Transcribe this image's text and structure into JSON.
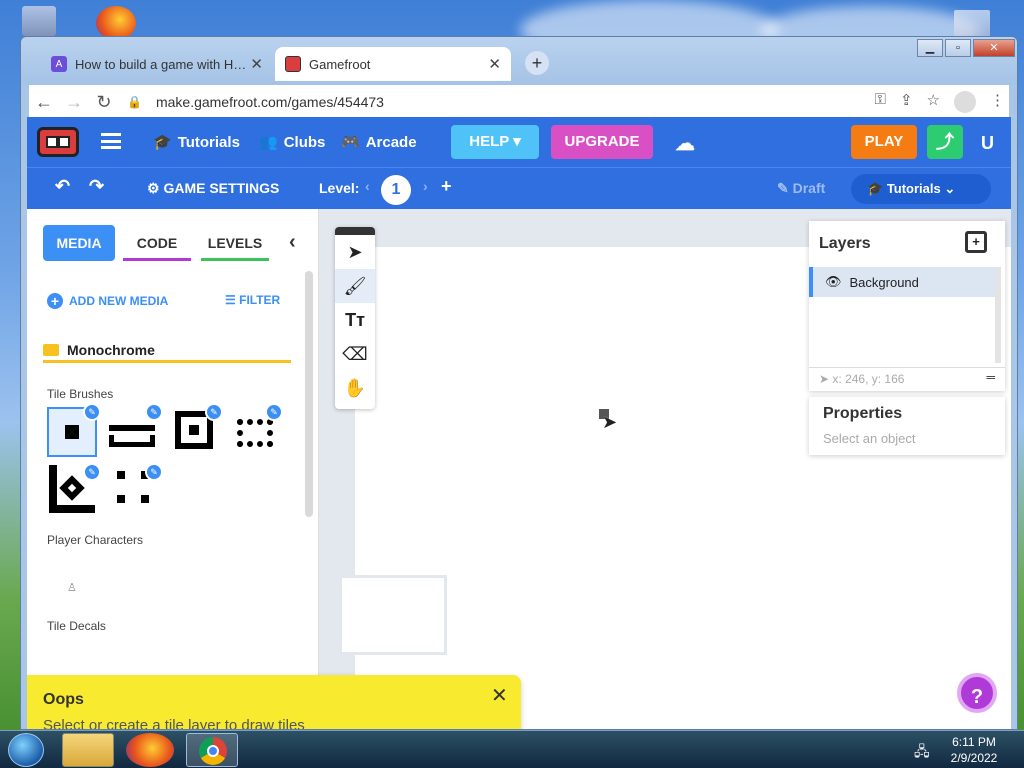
{
  "browser": {
    "tabs": [
      {
        "label": "How to build a game with HTML...",
        "favicon": "hashnode-icon"
      },
      {
        "label": "Gamefroot",
        "favicon": "gamefroot-icon"
      }
    ],
    "url": "make.gamefroot.com/games/454473"
  },
  "topnav": {
    "tutorials": "Tutorials",
    "clubs": "Clubs",
    "arcade": "Arcade",
    "help": "HELP",
    "upgrade": "UPGRADE",
    "play": "PLAY",
    "user_initial": "U"
  },
  "subnav": {
    "game_settings": "GAME SETTINGS",
    "level_label": "Level:",
    "level_number": "1",
    "draft": "Draft",
    "tutorials": "Tutorials"
  },
  "left_panel": {
    "tabs": [
      "MEDIA",
      "CODE",
      "LEVELS"
    ],
    "add_new_media": "ADD NEW MEDIA",
    "filter": "FILTER",
    "folder": "Monochrome",
    "sections": [
      "Tile Brushes",
      "Player Characters",
      "Tile Decals"
    ]
  },
  "layers": {
    "title": "Layers",
    "items": [
      "Background"
    ],
    "coords": "x: 246, y: 166"
  },
  "properties": {
    "title": "Properties",
    "hint": "Select an object"
  },
  "toast": {
    "title": "Oops",
    "message": "Select or create a tile layer to draw tiles"
  },
  "help_fab": "?",
  "taskbar": {
    "time": "6:11 PM",
    "date": "2/9/2022"
  },
  "colors": {
    "brand_blue": "#2f6fe0",
    "help": "#4fc3f7",
    "upgrade": "#d94fc4",
    "play": "#f57c12",
    "share": "#2ecc71",
    "toast": "#f7ea2f"
  }
}
